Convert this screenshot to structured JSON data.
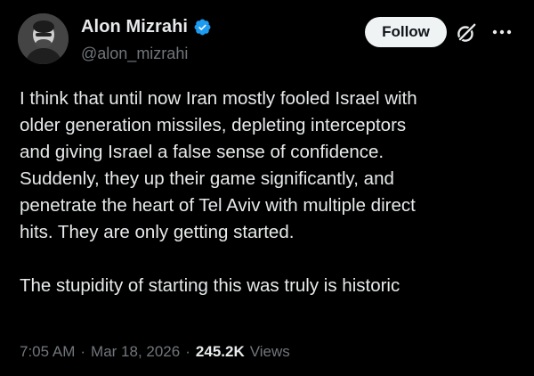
{
  "author": {
    "display_name": "Alon Mizrahi",
    "handle": "@alon_mizrahi",
    "verified": true
  },
  "actions": {
    "follow_label": "Follow"
  },
  "post": {
    "paragraph_1": "I think that until now Iran mostly fooled Israel with\nolder generation missiles, depleting interceptors\nand giving Israel a false sense of confidence.\nSuddenly, they up their game significantly, and\npenetrate the heart of Tel Aviv with multiple direct\nhits. They are only getting started.",
    "paragraph_2": "The stupidity of starting this was truly is historic"
  },
  "meta": {
    "time": "7:05 AM",
    "separator": "·",
    "date": "Mar 18, 2026",
    "views_count": "245.2K",
    "views_label": "Views"
  },
  "icons": {
    "verified": "verified-badge-icon",
    "grok": "grok-icon",
    "more": "more-horizontal-icon"
  },
  "colors": {
    "background": "#000000",
    "text": "#e7e9ea",
    "secondary_text": "#71767b",
    "verified_blue": "#1d9bf0",
    "follow_button_bg": "#eff3f4"
  }
}
